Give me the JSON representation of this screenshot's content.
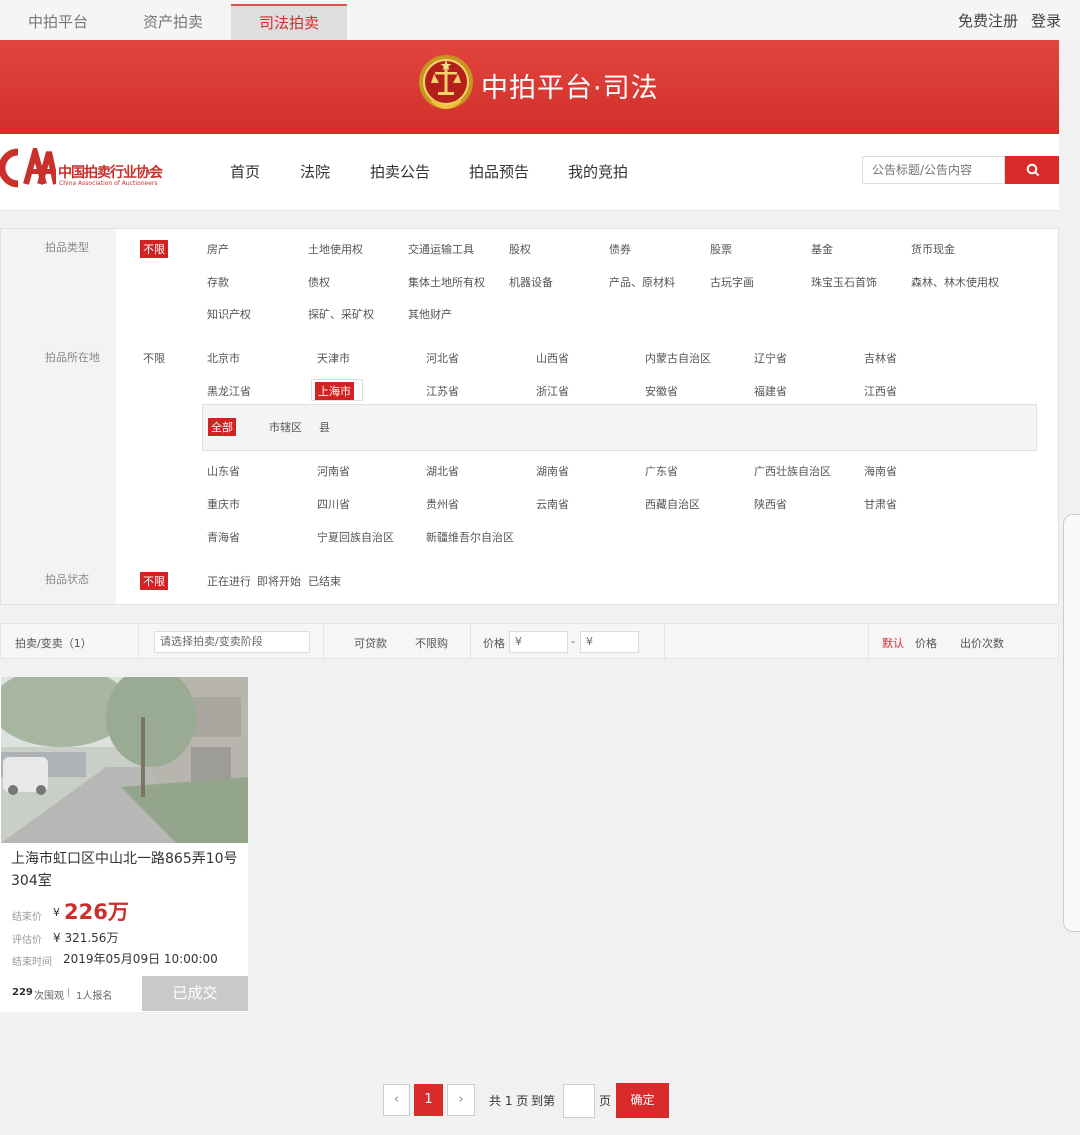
{
  "topbar": {
    "tabs": [
      "中拍平台",
      "资产拍卖",
      "司法拍卖"
    ],
    "register": "免费注册",
    "login": "登录"
  },
  "banner": {
    "title": "中拍平台·司法"
  },
  "logo": {
    "cn": "中国拍卖行业协会",
    "en": "China Association of Auctioneers",
    "mark": "CAA"
  },
  "nav": {
    "items": [
      "首页",
      "法院",
      "拍卖公告",
      "拍品预告",
      "我的竞拍"
    ]
  },
  "search": {
    "placeholder": "公告标题/公告内容"
  },
  "filter": {
    "type_label": "拍品类型",
    "type_all": "不限",
    "types": [
      "房产",
      "土地使用权",
      "交通运输工具",
      "股权",
      "债券",
      "股票",
      "基金",
      "货币现金",
      "存款",
      "债权",
      "集体土地所有权",
      "机器设备",
      "产品、原材料",
      "古玩字画",
      "珠宝玉石首饰",
      "森林、林木使用权",
      "知识产权",
      "探矿、采矿权",
      "其他财产"
    ],
    "loc_label": "拍品所在地",
    "loc_all": "不限",
    "locs_a": [
      "北京市",
      "天津市",
      "河北省",
      "山西省",
      "内蒙古自治区",
      "辽宁省",
      "吉林省",
      "黑龙江省",
      "上海市",
      "江苏省",
      "浙江省",
      "安徽省",
      "福建省",
      "江西省"
    ],
    "sub": [
      "全部",
      "市辖区",
      "县"
    ],
    "locs_b": [
      "山东省",
      "河南省",
      "湖北省",
      "湖南省",
      "广东省",
      "广西壮族自治区",
      "海南省",
      "重庆市",
      "四川省",
      "贵州省",
      "云南省",
      "西藏自治区",
      "陕西省",
      "甘肃省",
      "青海省",
      "宁夏回族自治区",
      "新疆维吾尔自治区"
    ],
    "status_label": "拍品状态",
    "status_all": "不限",
    "statuses": [
      "正在进行",
      "即将开始",
      "已结束"
    ]
  },
  "sortbar": {
    "count_label": "拍卖/变卖（1）",
    "stage_placeholder": "请选择拍卖/变卖阶段",
    "loan": "可贷款",
    "no_limit": "不限购",
    "price_label": "价格",
    "price_from": "¥",
    "dash": "-",
    "price_to": "¥",
    "sorts": [
      "默认",
      "价格",
      "出价次数"
    ]
  },
  "card": {
    "title": "上海市虹口区中山北一路865弄10号304室",
    "end_price_label": "结束价",
    "yen": "¥",
    "end_price": "226万",
    "eval_label": "评估价",
    "eval_value": "¥ 321.56万",
    "end_time_label": "结束时间",
    "end_time": "2019年05月09日 10:00:00",
    "views": "229",
    "views_suffix": "次围观",
    "sep": "|",
    "signups": "1人报名",
    "button": "已成交"
  },
  "pagination": {
    "prev": "‹",
    "current": "1",
    "next": "›",
    "total": "共 1 页",
    "goto": "到第",
    "page_unit": "页",
    "ok": "确定"
  },
  "colors": {
    "accent": "#d92b2b",
    "banner": "#d9332d"
  },
  "icons": [
    "court-emblem-icon",
    "search-icon",
    "chevron-left-icon",
    "chevron-right-icon"
  ]
}
